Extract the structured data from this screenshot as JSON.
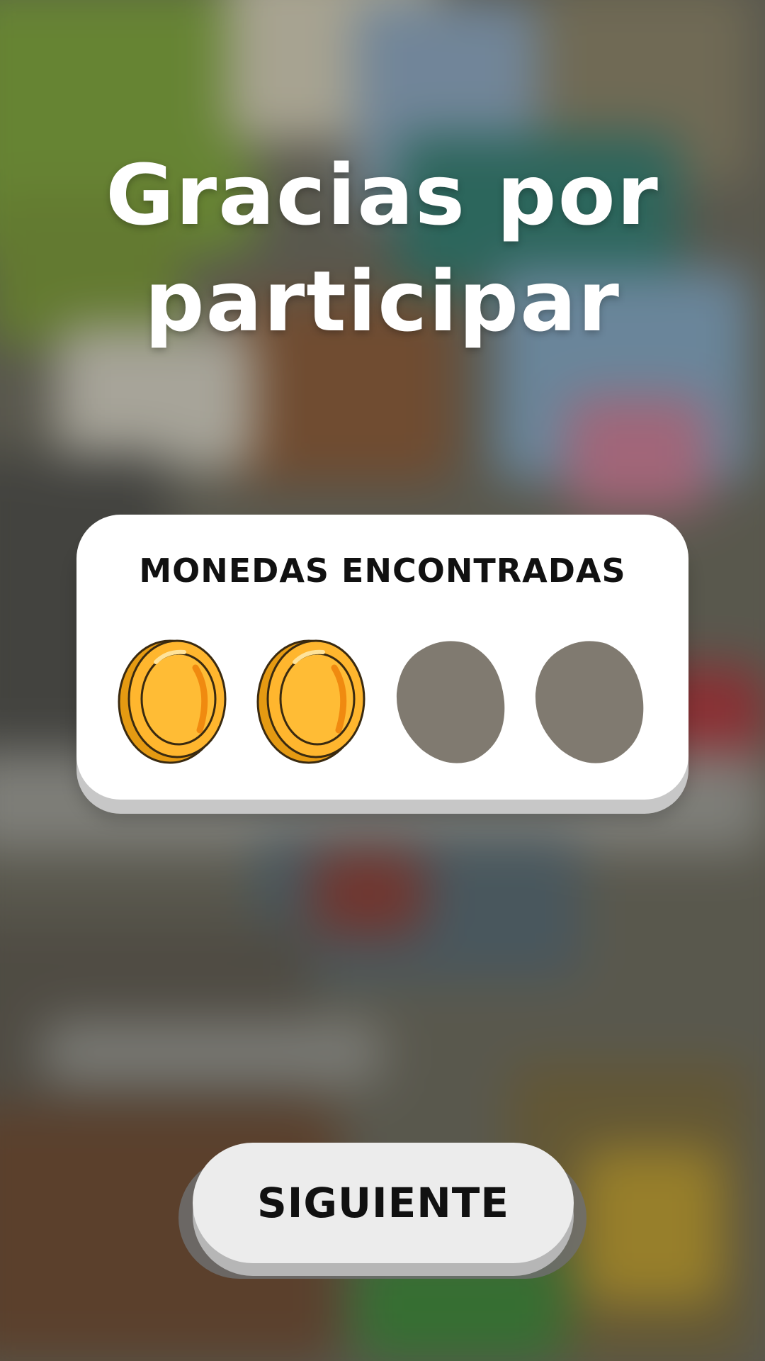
{
  "title": {
    "line1": "Gracias por",
    "line2": "participar"
  },
  "coins_panel": {
    "heading": "MONEDAS ENCONTRADAS",
    "total_coins": 4,
    "found_coins": 2,
    "slots": [
      {
        "state": "found",
        "icon": "gold-coin-icon"
      },
      {
        "state": "found",
        "icon": "gold-coin-icon"
      },
      {
        "state": "missing",
        "icon": "coin-silhouette-icon"
      },
      {
        "state": "missing",
        "icon": "coin-silhouette-icon"
      }
    ]
  },
  "next_button": {
    "label": "SIGUIENTE"
  },
  "colors": {
    "coin_gold": "#ffb62e",
    "coin_rim": "#f4a21a",
    "coin_outline": "#3a2a10",
    "coin_missing": "#807a70",
    "panel_bg": "#ffffff",
    "button_bg": "#ececec"
  }
}
